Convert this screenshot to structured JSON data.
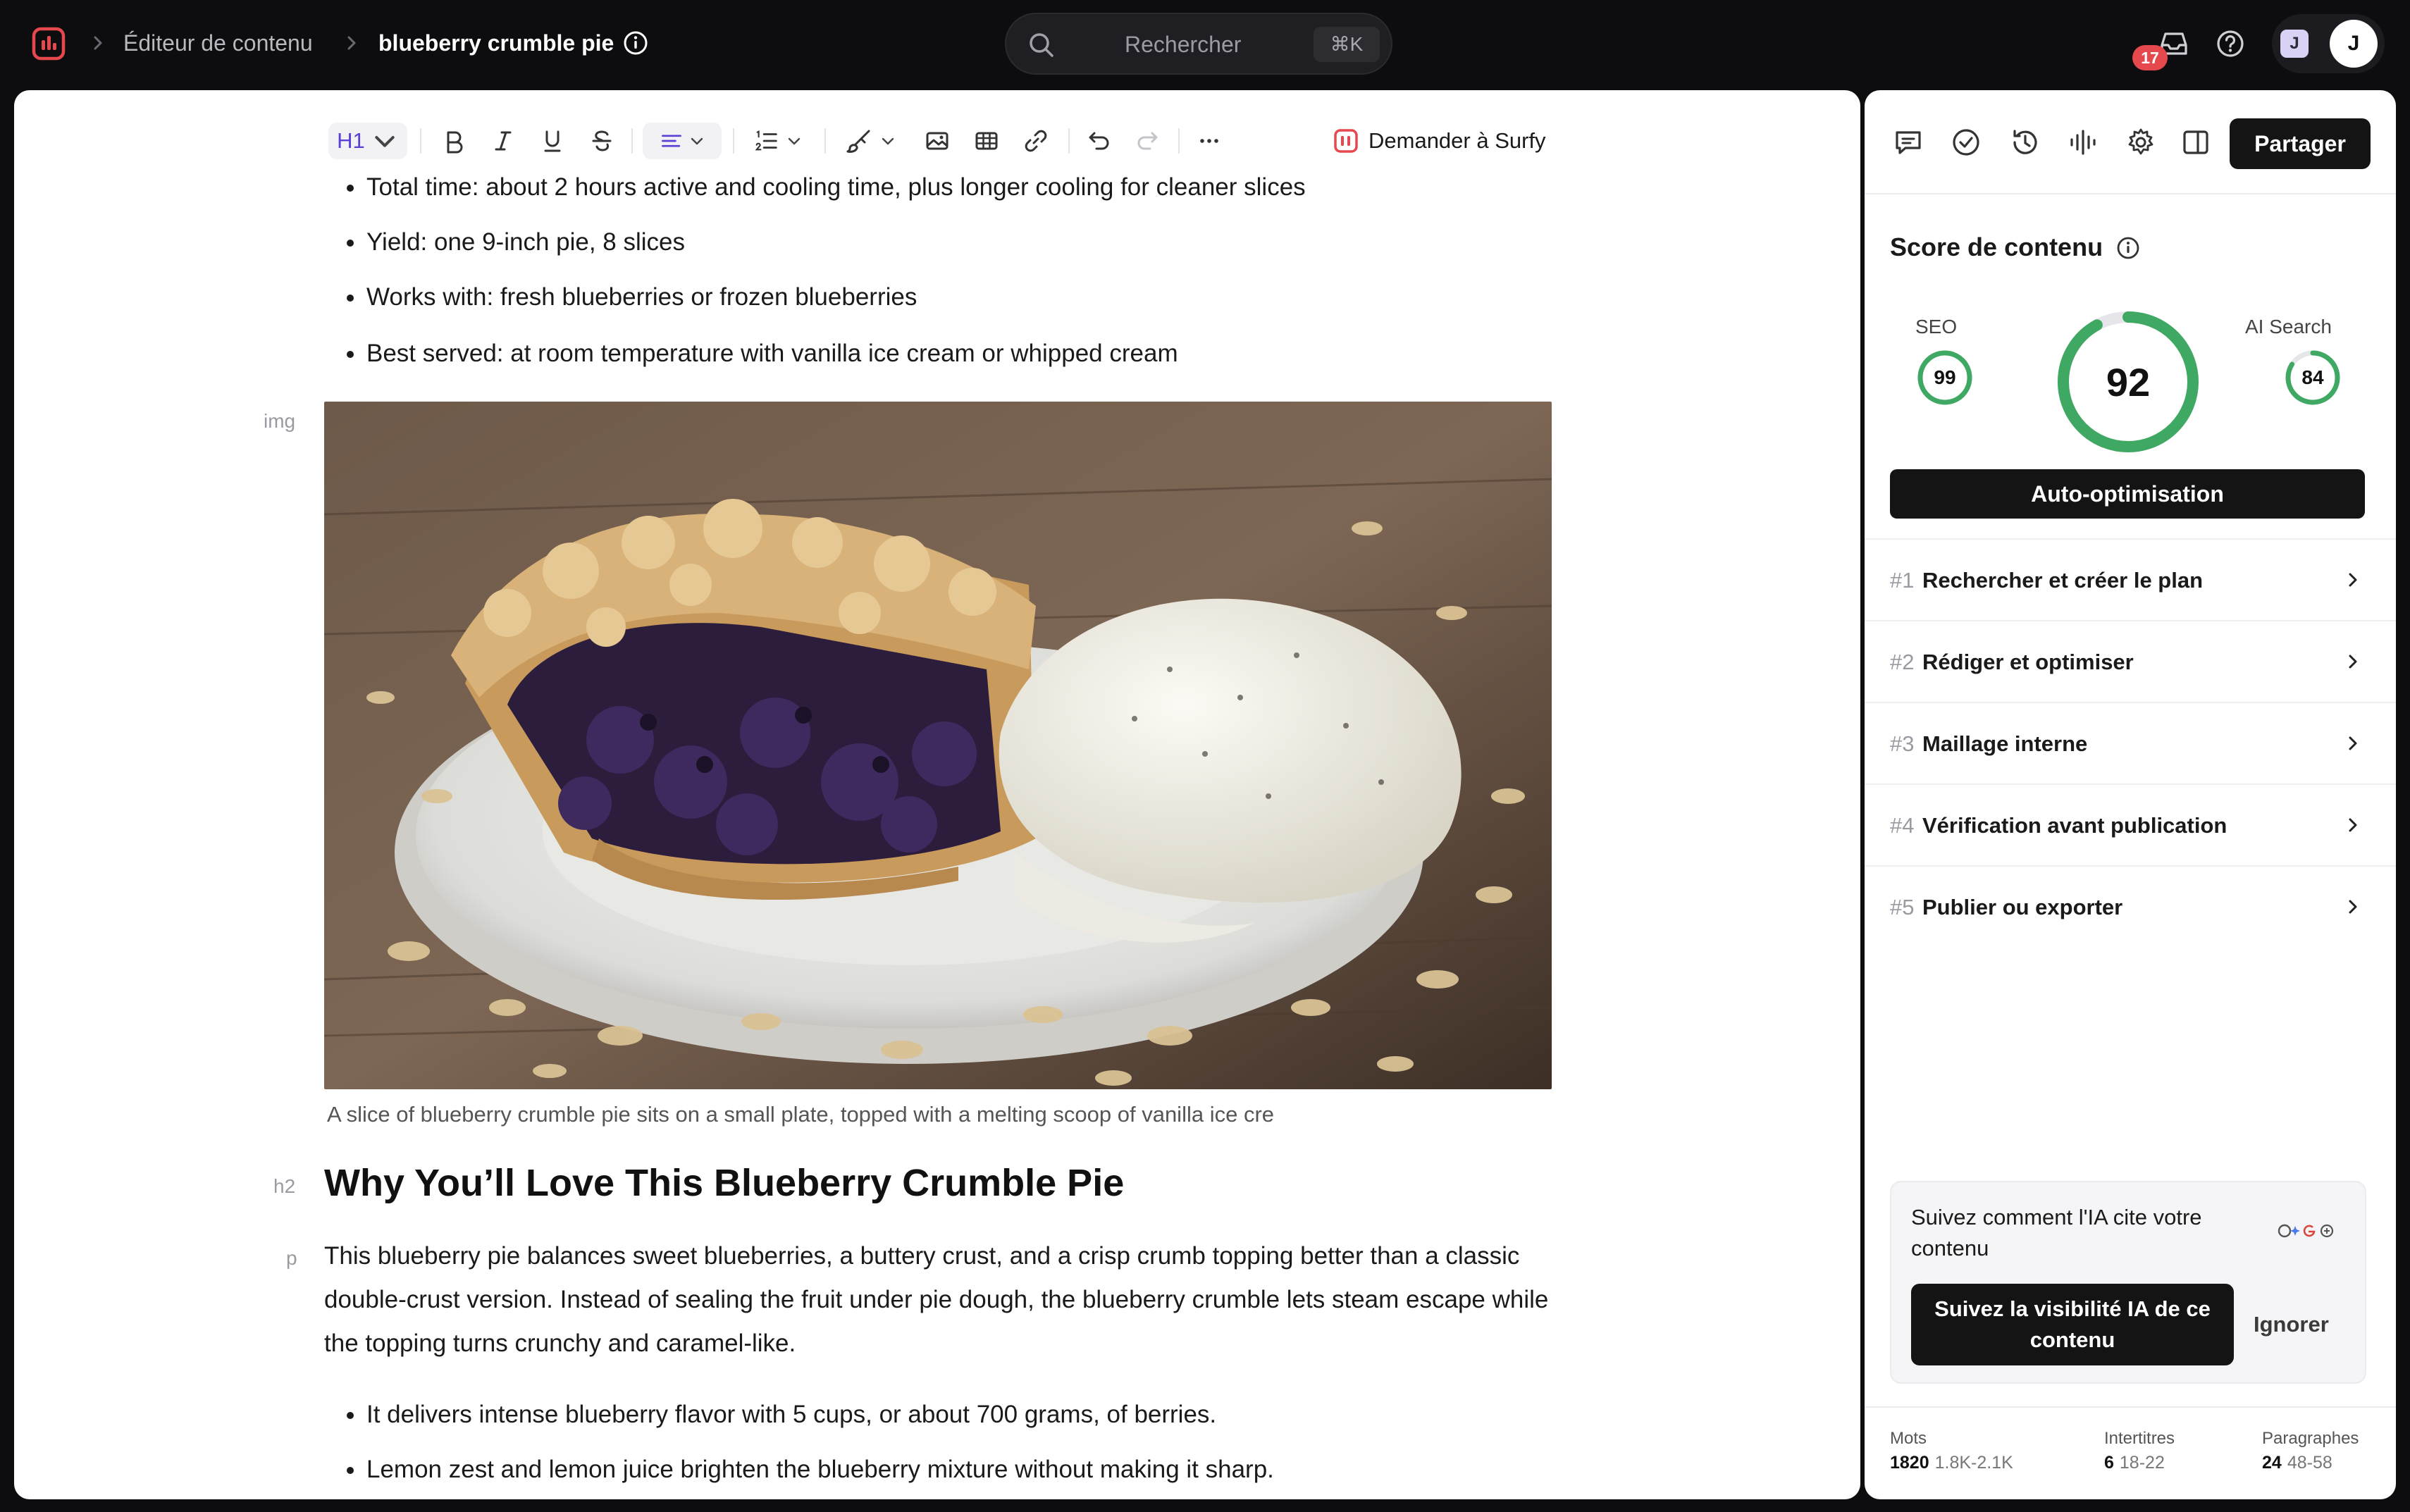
{
  "breadcrumb": {
    "section": "Éditeur de contenu",
    "current": "blueberry crumble pie"
  },
  "search": {
    "placeholder": "Rechercher",
    "shortcut": "⌘K"
  },
  "notifications": {
    "count": "17"
  },
  "avatars": {
    "workspace_initial": "J",
    "user_initial": "J"
  },
  "toolbar": {
    "heading_level": "H1",
    "ask_ai_label": "Demander à Surfy"
  },
  "document": {
    "bullets_top": [
      "Total time: about 2 hours active and cooling time, plus longer cooling for cleaner slices",
      "Yield: one 9-inch pie, 8 slices",
      "Works with: fresh blueberries or frozen blueberries",
      "Best served: at room temperature with vanilla ice cream or whipped cream"
    ],
    "img_tag": "img",
    "image_caption": "A slice of blueberry crumble pie sits on a small plate, topped with a melting scoop of vanilla ice cre",
    "h2_tag": "h2",
    "heading": "Why You’ll Love This Blueberry Crumble Pie",
    "p_tag": "p",
    "paragraph": "This blueberry pie balances sweet blueberries, a buttery crust, and a crisp crumb topping better than a classic double-crust version. Instead of sealing the fruit under pie dough, the blueberry crumble lets steam escape while the topping turns crunchy and caramel-like.",
    "bullets_bottom": [
      "It delivers intense blueberry flavor with 5 cups, or about 700 grams, of berries.",
      "Lemon zest and lemon juice brighten the blueberry mixture without making it sharp."
    ]
  },
  "sidebar": {
    "share_label": "Partager",
    "score": {
      "title": "Score de contenu",
      "overall": 92,
      "seo_label": "SEO",
      "seo": 99,
      "ai_label": "AI Search",
      "ai": 84,
      "auto_button": "Auto-optimisation"
    },
    "steps": [
      {
        "num": "#1",
        "label": "Rechercher et créer le plan"
      },
      {
        "num": "#2",
        "label": "Rédiger et optimiser"
      },
      {
        "num": "#3",
        "label": "Maillage interne"
      },
      {
        "num": "#4",
        "label": "Vérification avant publication"
      },
      {
        "num": "#5",
        "label": "Publier ou exporter"
      }
    ],
    "tracking": {
      "text": "Suivez comment l'IA cite votre contenu",
      "button": "Suivez la visibilité IA de ce contenu",
      "ignore": "Ignorer"
    },
    "stats": {
      "words_label": "Mots",
      "words_value": "1820",
      "words_range": "1.8K-2.1K",
      "headings_label": "Intertitres",
      "headings_value": "6",
      "headings_range": "18-22",
      "paragraphs_label": "Paragraphes",
      "paragraphs_value": "24",
      "paragraphs_range": "48-58"
    }
  },
  "colors": {
    "accent_green": "#3fa863",
    "brand_red": "#e5484d",
    "toolbar_accent": "#5b3fd6"
  }
}
